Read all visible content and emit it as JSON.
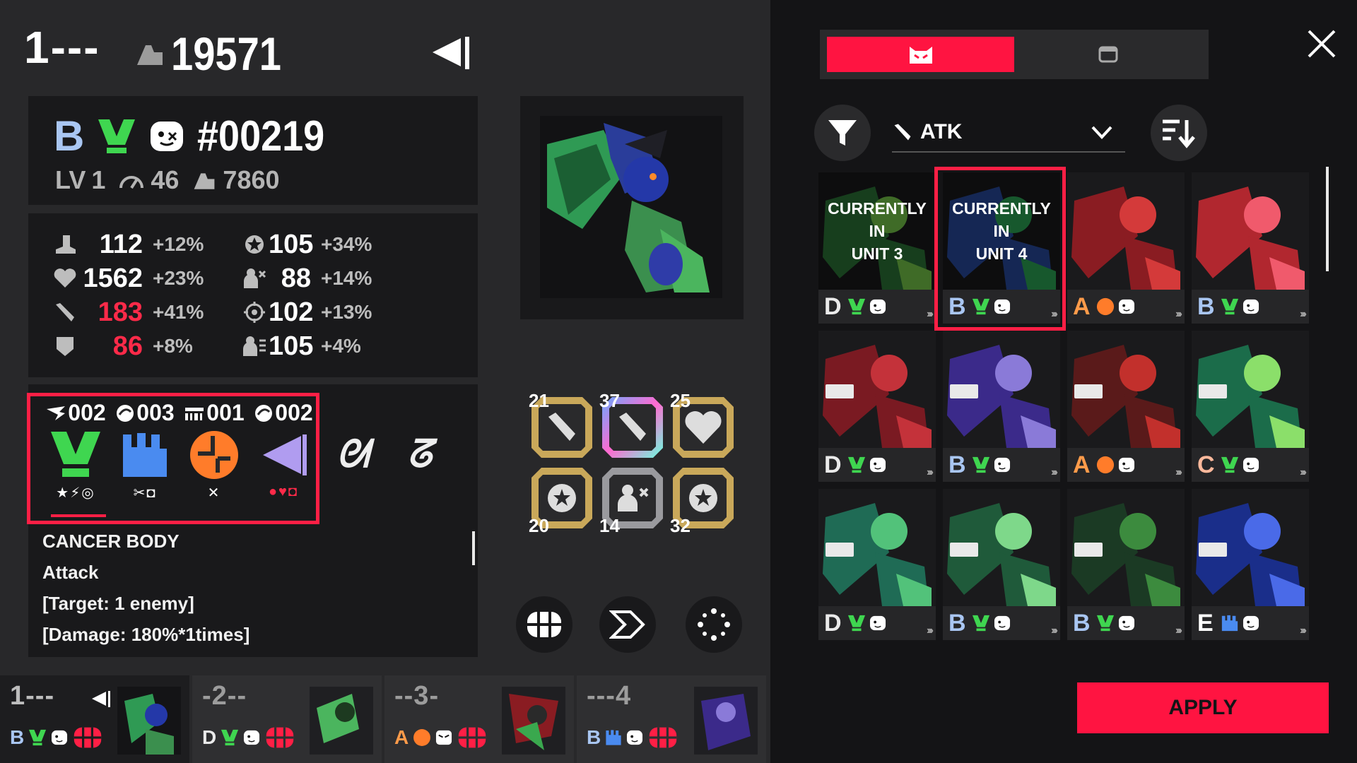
{
  "header": {
    "slot": "1---",
    "power": "19571"
  },
  "idcard": {
    "rank": "B",
    "id": "#00219",
    "lv_label": "LV",
    "level": "1",
    "speed": "46",
    "power": "7860"
  },
  "stats": [
    {
      "icon": "boot-icon",
      "value": "112",
      "bonus": "+12%",
      "red": false
    },
    {
      "icon": "heart-icon",
      "value": "1562",
      "bonus": "+23%",
      "red": false
    },
    {
      "icon": "blade-icon",
      "value": "183",
      "bonus": "+41%",
      "red": true
    },
    {
      "icon": "shield-icon",
      "value": "86",
      "bonus": "+8%",
      "red": true
    },
    {
      "icon": "crit-icon",
      "value": "105",
      "bonus": "+34%",
      "red": false
    },
    {
      "icon": "evade-icon",
      "value": "88",
      "bonus": "+14%",
      "red": false
    },
    {
      "icon": "accuracy-icon",
      "value": "102",
      "bonus": "+13%",
      "red": false
    },
    {
      "icon": "resist-icon",
      "value": "105",
      "bonus": "+4%",
      "red": false
    }
  ],
  "abilities": [
    {
      "count": "002",
      "name": "v-body-icon",
      "color": "#3fd650",
      "subs": "★⚡◎"
    },
    {
      "count": "003",
      "name": "hand-icon",
      "color": "#4a8bf0",
      "subs": "✂◘"
    },
    {
      "count": "001",
      "name": "orange-disc-icon",
      "color": "#ff7c2a",
      "subs": "✕"
    },
    {
      "count": "002",
      "name": "cone-icon",
      "color": "#b09cf0",
      "subs": "●♥◘"
    }
  ],
  "description": {
    "lines": [
      "CANCER BODY",
      "Attack",
      "[Target: 1 enemy]",
      "[Damage: 180%*1times]"
    ]
  },
  "equipment": [
    {
      "value": "21",
      "icon": "blade-icon",
      "tier": "gold"
    },
    {
      "value": "37",
      "icon": "blade-icon",
      "tier": "holo"
    },
    {
      "value": "25",
      "icon": "heart-icon",
      "tier": "gold"
    },
    {
      "value": "20",
      "icon": "crit-icon",
      "tier": "gold"
    },
    {
      "value": "14",
      "icon": "evade-icon",
      "tier": "silver"
    },
    {
      "value": "32",
      "icon": "crit-icon",
      "tier": "gold"
    }
  ],
  "units": [
    {
      "label": "1---",
      "ranks": "B",
      "active": true
    },
    {
      "label": "-2--",
      "ranks": "D",
      "active": false
    },
    {
      "label": "--3-",
      "ranks": "A",
      "active": false
    },
    {
      "label": "---4",
      "ranks": "B",
      "active": false
    }
  ],
  "right": {
    "sort_label": "ATK",
    "apply": "APPLY",
    "cards": [
      {
        "rank": "D",
        "overlay": "CURRENTLY IN\nUNIT 3",
        "c1": "#2e7d3a",
        "c2": "#7fd64f"
      },
      {
        "rank": "B",
        "overlay": "CURRENTLY IN\nUNIT 4",
        "c1": "#2a4fa8",
        "c2": "#2fb15a"
      },
      {
        "rank": "A",
        "overlay": "",
        "c1": "#8a1c22",
        "c2": "#d43a3a"
      },
      {
        "rank": "B",
        "overlay": "",
        "c1": "#b1272f",
        "c2": "#f05a6c"
      },
      {
        "rank": "D",
        "overlay": "",
        "c1": "#7a1a22",
        "c2": "#c4323a"
      },
      {
        "rank": "B",
        "overlay": "",
        "c1": "#3b2a8a",
        "c2": "#8a7ad8"
      },
      {
        "rank": "A",
        "overlay": "",
        "c1": "#5a1a1a",
        "c2": "#c2302c"
      },
      {
        "rank": "C",
        "overlay": "",
        "c1": "#1b6c4a",
        "c2": "#8bdf6a"
      },
      {
        "rank": "D",
        "overlay": "",
        "c1": "#1f6b55",
        "c2": "#52c27a"
      },
      {
        "rank": "B",
        "overlay": "",
        "c1": "#1f5a3a",
        "c2": "#7ed88a"
      },
      {
        "rank": "B",
        "overlay": "",
        "c1": "#1b3a24",
        "c2": "#3c8b3e"
      },
      {
        "rank": "E",
        "overlay": "",
        "c1": "#1a2e8a",
        "c2": "#4a6ae8"
      }
    ]
  },
  "colors": {
    "accent": "#ff1441",
    "panel": "#19191b",
    "bg": "#28282a"
  }
}
